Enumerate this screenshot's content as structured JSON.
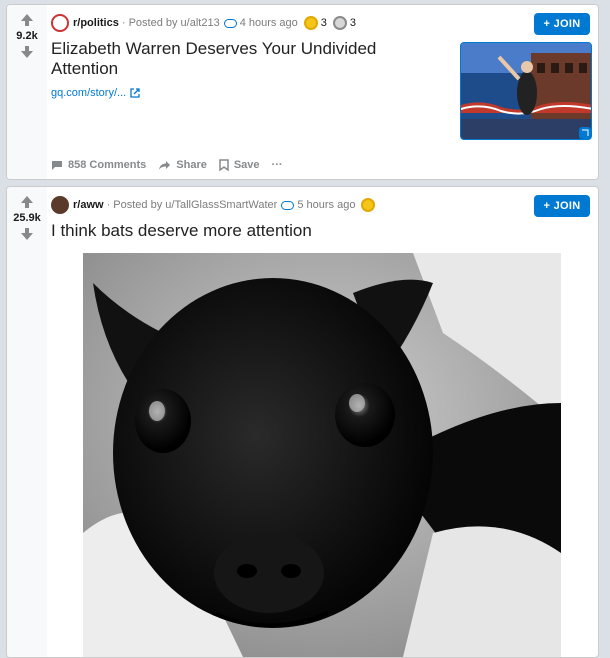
{
  "posts": [
    {
      "score": "9.2k",
      "subreddit": "r/politics",
      "posted_by": "· Posted by u/alt213",
      "time": "4 hours ago",
      "awards": [
        {
          "icon": "gold-award-icon",
          "count": "3"
        },
        {
          "icon": "silver-award-icon",
          "count": "3"
        }
      ],
      "join_label": "+ JOIN",
      "title_line1": "Elizabeth Warren Deserves Your Undivided",
      "title_line2": "Attention",
      "link": "gq.com/story/...",
      "actions": {
        "comments": "858 Comments",
        "share": "Share",
        "save": "Save",
        "more": "···"
      }
    },
    {
      "score": "25.9k",
      "subreddit": "r/aww",
      "posted_by": "· Posted by u/TallGlassSmartWater",
      "time": "5 hours ago",
      "awards": [
        {
          "icon": "gold-award-icon"
        }
      ],
      "join_label": "+ JOIN",
      "title": "I think bats deserve more attention"
    }
  ],
  "colors": {
    "accent": "#0079d3",
    "background": "#dae0e6",
    "upvote": "#878a8c"
  }
}
